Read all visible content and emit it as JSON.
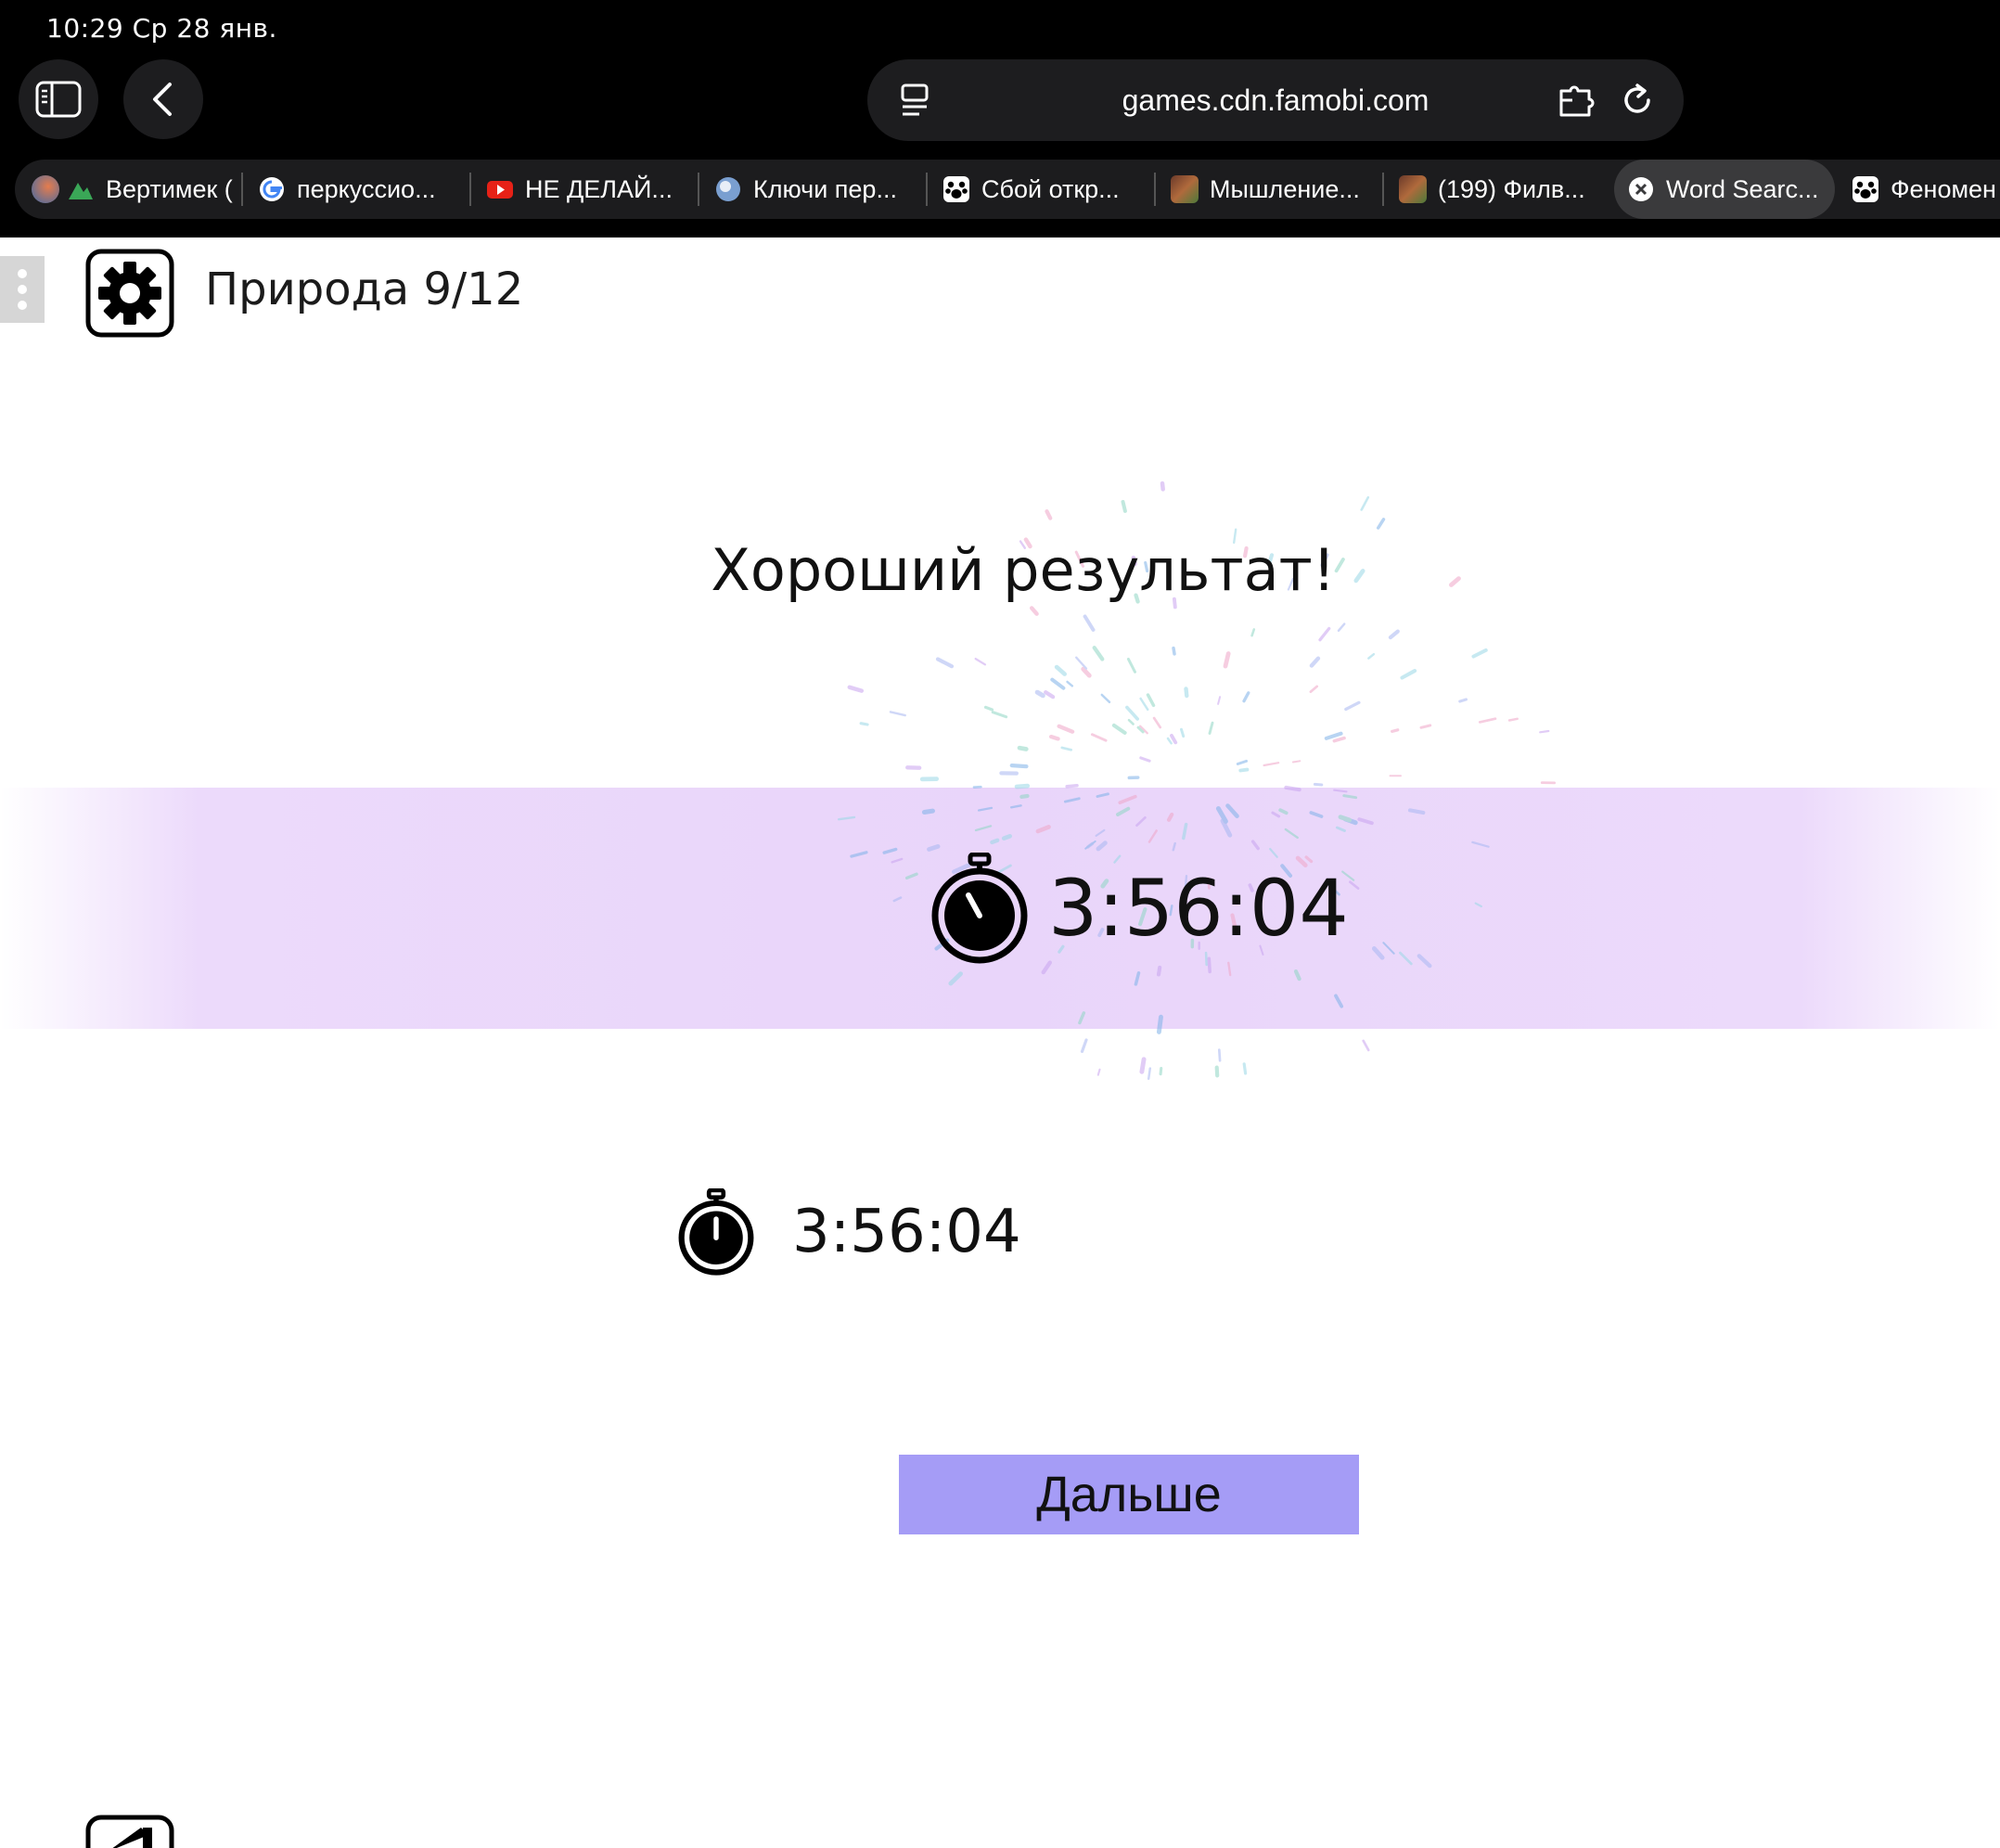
{
  "status_bar": {
    "time_date": "10:29   Ср 28 янв."
  },
  "address_bar": {
    "url": "games.cdn.famobi.com"
  },
  "tabs": [
    {
      "label": "Вертимек (",
      "icon": "mountain-icon"
    },
    {
      "label": "перкуссио...",
      "icon": "google-icon"
    },
    {
      "label": "НЕ ДЕЛАЙ...",
      "icon": "youtube-icon"
    },
    {
      "label": "Ключи пер...",
      "icon": "globe-icon"
    },
    {
      "label": "Сбой откр...",
      "icon": "paw-icon"
    },
    {
      "label": "Мышление...",
      "icon": "image-thumb-icon"
    },
    {
      "label": "(199) Филв...",
      "icon": "image-thumb-icon"
    },
    {
      "label": "Word Searc...",
      "icon": "close-icon",
      "active": true
    },
    {
      "label": "Феномен",
      "icon": "paw-icon"
    }
  ],
  "game": {
    "level_title": "Природа 9/12",
    "result_message": "Хороший результат!",
    "current_time": "3:56:04",
    "best_time": "3:56:04",
    "next_button": "Дальше"
  },
  "colors": {
    "band": "#e9d5fa",
    "button": "#a59cf6",
    "chrome": "#000000"
  }
}
